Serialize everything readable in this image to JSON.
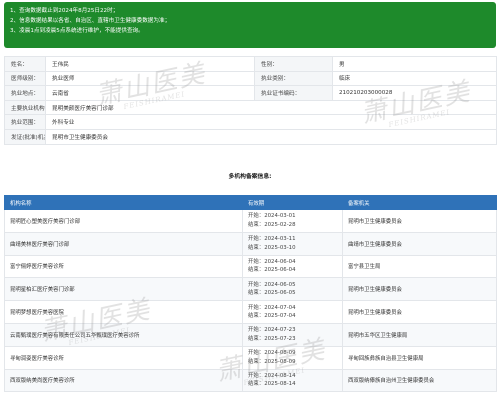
{
  "notice": {
    "lines": [
      "1、查询数据截止到2024年8月25日22时；",
      "2、信息数据结果以各省、自治区、直辖市卫生健康委数据为准；",
      "3、凌晨1点到凌晨5点系统进行维护，不能提供查询。"
    ]
  },
  "info": {
    "name_label": "姓名：",
    "name_value": "王伟民",
    "gender_label": "性别：",
    "gender_value": "男",
    "level_label": "医师级别：",
    "level_value": "执业医师",
    "category_label": "执业类别：",
    "category_value": "临床",
    "location_label": "执业地点：",
    "location_value": "云南省",
    "cert_label": "执业证书编码：",
    "cert_value": "210210203000028",
    "org_label": "主要执业机构：",
    "org_value": "昆明美颜医疗美容门诊部",
    "scope_label": "执业范围：",
    "scope_value": "外科专业",
    "authority_label": "发证(批准)机关：",
    "authority_value": "昆明市卫生健康委员会"
  },
  "registry": {
    "title": "多机构备案信息:",
    "headers": [
      "机构名称",
      "有效期",
      "备案机关"
    ],
    "start_prefix": "开始：",
    "end_prefix": "结束：",
    "rows": [
      {
        "name": "昆明匠心塑美医疗美容门诊部",
        "start": "2024-03-01",
        "end": "2025-02-28",
        "authority": "昆明市卫生健康委员会"
      },
      {
        "name": "曲靖美林医疗美容门诊部",
        "start": "2024-03-11",
        "end": "2025-03-10",
        "authority": "曲靖市卫生健康委员会"
      },
      {
        "name": "富宁俪婷医疗美容诊所",
        "start": "2024-06-04",
        "end": "2025-06-04",
        "authority": "富宁县卫生局"
      },
      {
        "name": "昆明星柏汇医疗美容门诊部",
        "start": "2024-06-05",
        "end": "2025-06-05",
        "authority": "昆明市卫生健康委员会"
      },
      {
        "name": "昆明梦想医疗美容医院",
        "start": "2024-07-04",
        "end": "2025-07-04",
        "authority": "昆明市卫生健康委员会"
      },
      {
        "name": "云南甄璞医疗美容有限责任公司五华甄璞医疗美容诊所",
        "start": "2024-07-23",
        "end": "2025-07-23",
        "authority": "昆明市五华区卫生健康局"
      },
      {
        "name": "寻甸润姿医疗美容诊所",
        "start": "2024-08-09",
        "end": "2025-08-09",
        "authority": "寻甸回族彝族自治县卫生健康局"
      },
      {
        "name": "西双版纳美尚医疗美容诊所",
        "start": "2024-08-14",
        "end": "2025-08-14",
        "authority": "西双版纳傣族自治州卫生健康委员会"
      }
    ]
  },
  "watermark": {
    "main": "萧山医美",
    "sub": "FEISHIRAMEI"
  }
}
